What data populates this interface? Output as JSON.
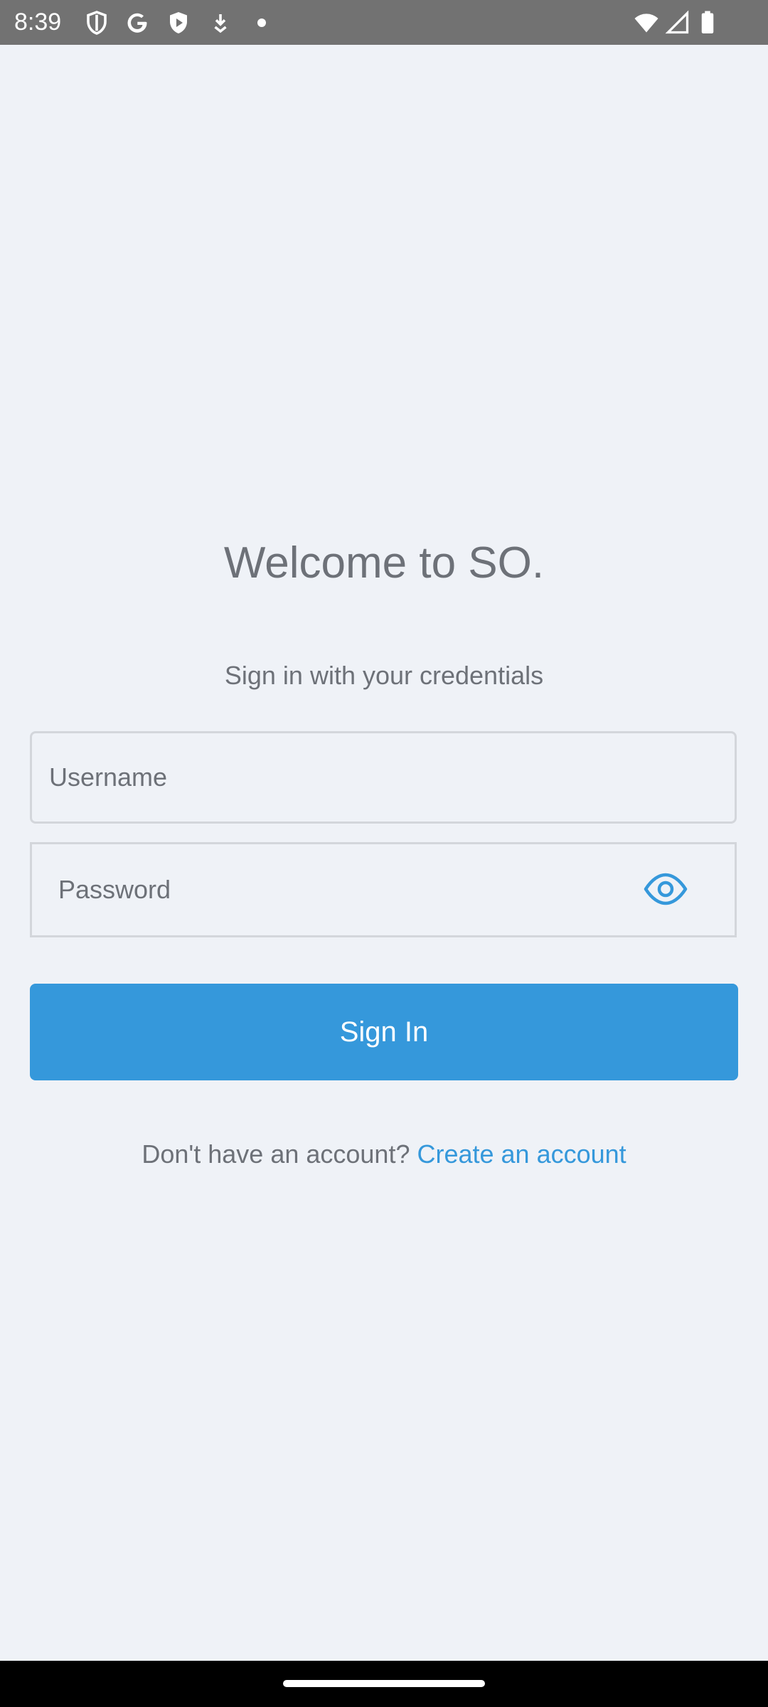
{
  "status_bar": {
    "time": "8:39",
    "left_icons": [
      "shield-outline-icon",
      "google-g-icon",
      "shield-play-icon",
      "download-arrow-icon",
      "dot-icon"
    ],
    "right_icons": [
      "wifi-icon",
      "cell-signal-icon",
      "battery-icon"
    ]
  },
  "login": {
    "title": "Welcome to SO.",
    "subtitle": "Sign in with your credentials",
    "username_placeholder": "Username",
    "username_value": "",
    "password_placeholder": "Password",
    "password_value": "",
    "password_toggle_icon": "eye-icon",
    "sign_in_label": "Sign In",
    "no_account_text": "Don't have an account?",
    "create_account_label": "Create an account"
  },
  "colors": {
    "background": "#eff2f7",
    "accent": "#3598db",
    "text_muted": "#6d7178",
    "field_border": "#d3d6db",
    "status_bar": "#727272"
  }
}
